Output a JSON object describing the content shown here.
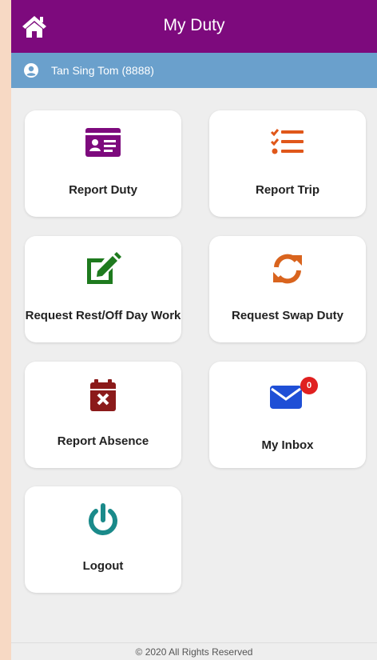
{
  "header": {
    "title": "My Duty",
    "home_icon": "home-icon"
  },
  "user": {
    "name": "Tan Sing Tom (8888)",
    "icon": "user-circle-icon"
  },
  "menu": [
    {
      "label": "Report Duty",
      "icon": "id-card-icon",
      "color": "#7d0a7d"
    },
    {
      "label": "Report Trip",
      "icon": "checklist-icon",
      "color": "#e0571a"
    },
    {
      "label": "Request Rest/Off Day Work",
      "icon": "edit-icon",
      "color": "#1e7a1e"
    },
    {
      "label": "Request Swap Duty",
      "icon": "sync-icon",
      "color": "#d9641e"
    },
    {
      "label": "Report Absence",
      "icon": "calendar-x-icon",
      "color": "#8b1a1a"
    },
    {
      "label": "My Inbox",
      "icon": "envelope-icon",
      "color": "#1f4fd6",
      "badge": "0"
    },
    {
      "label": "Logout",
      "icon": "power-icon",
      "color": "#1a8a8a"
    }
  ],
  "footer": {
    "text": "© 2020 All Rights Reserved"
  },
  "colors": {
    "header": "#7d0a7d",
    "userbar": "#6aa0cc",
    "side": "#f7d9c4",
    "badge": "#e02020"
  }
}
